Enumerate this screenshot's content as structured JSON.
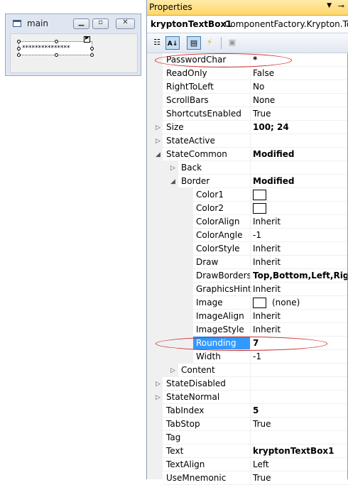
{
  "form": {
    "title": "main",
    "textbox_value": "***************",
    "minimize_icon": "minimize-icon",
    "maximize_icon": "maximize-icon",
    "close_icon": "close-icon"
  },
  "properties": {
    "window_title": "Properties",
    "object_name": "kryptonTextBox1",
    "object_type": "ComponentFactory.Krypton.Too",
    "rows": [
      {
        "name": "PasswordChar",
        "value": "*",
        "bold": true
      },
      {
        "name": "ReadOnly",
        "value": "False"
      },
      {
        "name": "RightToLeft",
        "value": "No"
      },
      {
        "name": "ScrollBars",
        "value": "None"
      },
      {
        "name": "ShortcutsEnabled",
        "value": "True"
      },
      {
        "name": "Size",
        "value": "100; 24",
        "bold": true
      },
      {
        "name": "StateActive",
        "value": ""
      },
      {
        "name": "StateCommon",
        "value": "Modified",
        "bold": true
      },
      {
        "name": "Back",
        "value": ""
      },
      {
        "name": "Border",
        "value": "Modified",
        "bold": true
      },
      {
        "name": "Color1",
        "value": ""
      },
      {
        "name": "Color2",
        "value": ""
      },
      {
        "name": "ColorAlign",
        "value": "Inherit"
      },
      {
        "name": "ColorAngle",
        "value": "-1"
      },
      {
        "name": "ColorStyle",
        "value": "Inherit"
      },
      {
        "name": "Draw",
        "value": "Inherit"
      },
      {
        "name": "DrawBorders",
        "value": "Top,Bottom,Left,Right",
        "bold": true
      },
      {
        "name": "GraphicsHint",
        "value": "Inherit"
      },
      {
        "name": "Image",
        "value": "(none)"
      },
      {
        "name": "ImageAlign",
        "value": "Inherit"
      },
      {
        "name": "ImageStyle",
        "value": "Inherit"
      },
      {
        "name": "Rounding",
        "value": "7",
        "bold": true
      },
      {
        "name": "Width",
        "value": "-1"
      },
      {
        "name": "Content",
        "value": ""
      },
      {
        "name": "StateDisabled",
        "value": ""
      },
      {
        "name": "StateNormal",
        "value": ""
      },
      {
        "name": "TabIndex",
        "value": "5",
        "bold": true
      },
      {
        "name": "TabStop",
        "value": "True"
      },
      {
        "name": "Tag",
        "value": ""
      },
      {
        "name": "Text",
        "value": "kryptonTextBox1",
        "bold": true
      },
      {
        "name": "TextAlign",
        "value": "Left"
      },
      {
        "name": "UseMnemonic",
        "value": "True"
      }
    ]
  },
  "toolbar": {
    "categorized_icon": "categorized-icon",
    "alphabetical_icon": "alphabetical-icon",
    "properties_icon": "properties-icon",
    "events_icon": "events-icon",
    "property_pages_icon": "property-pages-icon"
  },
  "colors": {
    "selection": "#3399ff",
    "annotation": "#cc2020",
    "title_bar": "#ffd76a"
  }
}
